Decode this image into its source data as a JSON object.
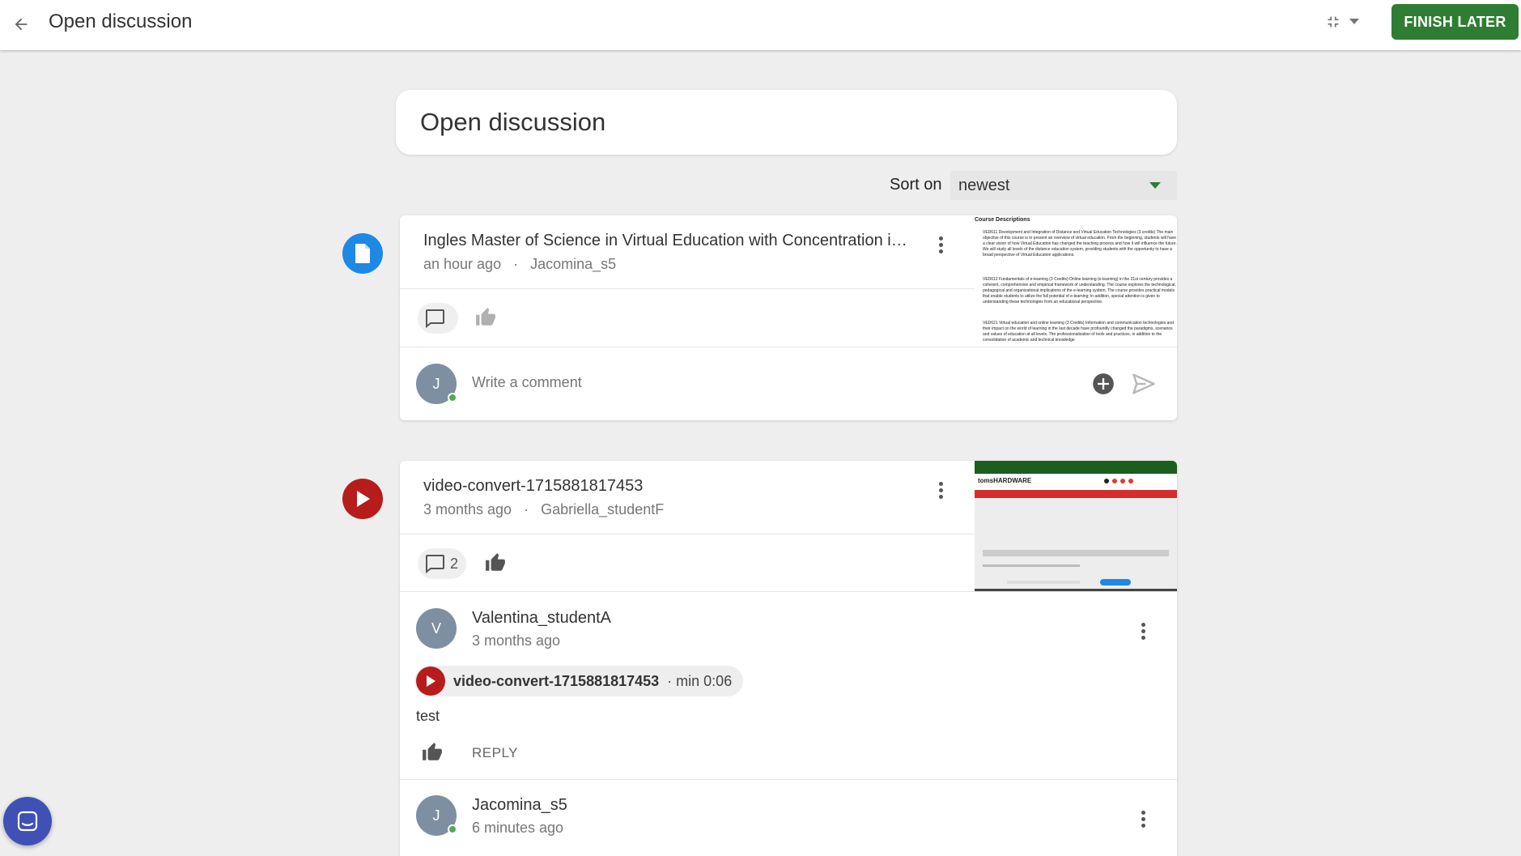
{
  "header": {
    "title": "Open discussion",
    "finish_label": "FINISH LATER"
  },
  "discussion": {
    "title": "Open discussion"
  },
  "sort": {
    "label": "Sort on",
    "value": "newest"
  },
  "posts": [
    {
      "type": "document",
      "title": "Ingles Master of Science in Virtual Education with Concentration i…",
      "time": "an hour ago",
      "author": "Jacomina_s5",
      "comment_count": "",
      "comment_placeholder": "Write a comment",
      "commenter_initial": "J",
      "thumbnail": {
        "heading": "Course Descriptions",
        "items": [
          "VED611 Development and Integration of Distance and Virtual Education Technologies (3 credits) The main objective of this course is to present an overview of virtual education. From the beginning, students will have a clear vision of how Virtual Education has changed the teaching process and how it will influence the future. We will study all levels of the distance education system, providing students with the opportunity to have a broad perspective of Virtual Education applications.",
          "VED612 Fundamentals of e-learning (3 Credits) Online learning (e-learning) in the 21st century provides a coherent, comprehensive and empirical framework of understanding. The course explores the technological, pedagogical and organizational implications of the e-learning system. The course provides practical models that enable students to utilize the full potential of e-learning; in addition, special attention is given to understanding these technologies from an educational perspective.",
          "VED621 Virtual education and online learning (3 Credits) Information and communication technologies and their impact on the world of learning in the last decade have profoundly changed the paradigms, scenarios and values of education at all levels. The professionalization of tools and practices, in addition to the consolidation of academic and technical knowledge"
        ]
      }
    },
    {
      "type": "video",
      "title": "video-convert-1715881817453",
      "time": "3 months ago",
      "author": "Gabriella_studentF",
      "comment_count": "2",
      "thumbnail": {
        "logo": "tomsHARDWARE"
      },
      "comments": [
        {
          "initial": "V",
          "name": "Valentina_studentA",
          "time": "3 months ago",
          "media_name": "video-convert-1715881817453",
          "media_time": "· min 0:06",
          "text": "test",
          "reply_label": "REPLY",
          "online": false
        },
        {
          "initial": "J",
          "name": "Jacomina_s5",
          "time": "6 minutes ago",
          "online": true
        }
      ]
    }
  ],
  "colors": {
    "accent": "#2e7d32",
    "doc_icon": "#1e88e5",
    "video_icon": "#b71c1c",
    "avatar": "#7d8fa0",
    "chat": "#3f51b5"
  },
  "icons": [
    "back-arrow-icon",
    "collapse-icon",
    "document-icon",
    "play-icon",
    "comment-icon",
    "thumbs-up-icon",
    "more-vert-icon",
    "add-circle-icon",
    "send-icon",
    "chat-icon"
  ]
}
